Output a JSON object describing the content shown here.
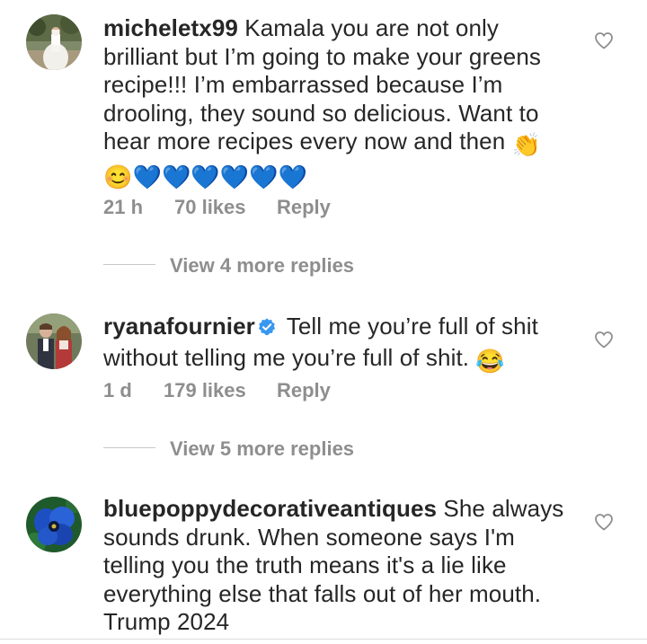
{
  "comments": [
    {
      "username": "micheletx99",
      "text_lines": [
        " Kamala you are not only",
        "brilliant but I’m going to make your greens",
        "recipe!!! I’m embarrassed because I’m",
        "drooling, they sound so delicious. Want to",
        "hear more recipes every now and then "
      ],
      "emoji_line": "😊💙💙💙💙💙💙",
      "emoji_after_text": "👏",
      "time": "21 h",
      "likes": "70 likes",
      "reply_label": "Reply",
      "view_replies": "View 4 more replies",
      "avatar_icon": "bride-in-garden-avatar"
    },
    {
      "username": "ryanafournier",
      "verified": true,
      "text_lines": [
        " Tell me you’re full of shit",
        "without telling me you’re full of shit. "
      ],
      "emoji_after_text": "😂",
      "time": "1 d",
      "likes": "179 likes",
      "reply_label": "Reply",
      "view_replies": "View 5 more replies",
      "avatar_icon": "couple-photo-avatar"
    },
    {
      "username": "bluepoppydecorativeantiques",
      "text_lines": [
        " She always",
        "sounds drunk. When someone says I'm",
        "telling you the truth means it's a lie like",
        "everything else that falls out of her mouth.",
        "Trump 2024"
      ],
      "avatar_icon": "blue-poppy-flower-avatar"
    }
  ],
  "colors": {
    "text": "#262626",
    "secondary": "#8e8e8e",
    "verified_blue": "#3897f0",
    "heart_outline": "#8e8e8e"
  }
}
